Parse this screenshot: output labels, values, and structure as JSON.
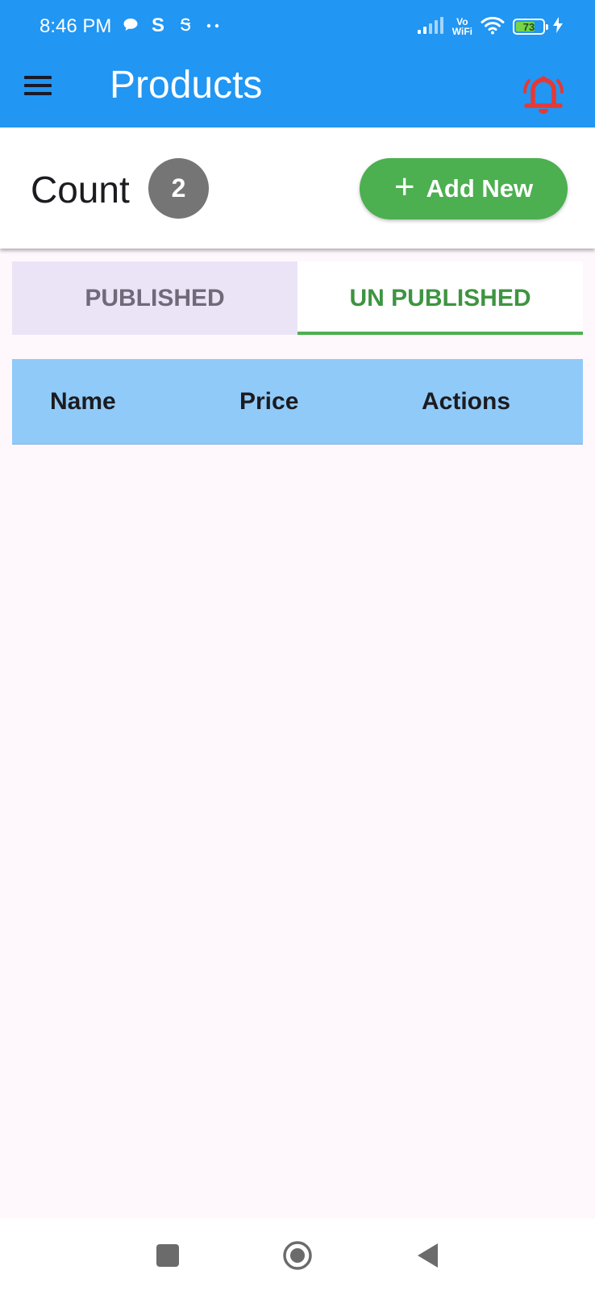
{
  "status_bar": {
    "time": "8:46 PM",
    "vowifi_top": "Vo",
    "vowifi_bottom": "WiFi",
    "battery_level": "73",
    "battery_fraction": 0.73
  },
  "app_bar": {
    "title": "Products",
    "background": "#2196f3",
    "bell_color": "#e53935"
  },
  "count_section": {
    "label": "Count",
    "value": "2",
    "add_button_label": "Add New",
    "add_button_color": "#4caf50"
  },
  "tabs": [
    {
      "label": "PUBLISHED",
      "selected": false
    },
    {
      "label": "UN PUBLISHED",
      "selected": true
    }
  ],
  "table": {
    "header_color": "#90caf9",
    "columns": [
      "Name",
      "Price",
      "Actions"
    ],
    "rows": []
  }
}
